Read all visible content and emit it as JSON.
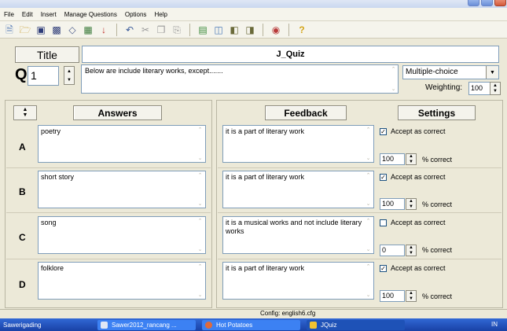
{
  "menu": [
    "File",
    "Edit",
    "Insert",
    "Manage Questions",
    "Options",
    "Help"
  ],
  "toolbar": {
    "icons": [
      "new-icon",
      "open-icon",
      "save-icon",
      "save-as-icon",
      "clear-icon",
      "export-icon",
      "insert-icon",
      "undo-icon",
      "cut-icon",
      "copy-icon",
      "paste-icon",
      "web-page-icon",
      "create-icon",
      "question-bank-icon",
      "quiz-icon",
      "tutorial-icon",
      "help-icon"
    ],
    "help_symbol": "?"
  },
  "title_label": "Title",
  "title_value": "J_Quiz",
  "question": {
    "label": "Q",
    "number": "1",
    "text": "Below are include literary works, except.......",
    "type": "Multiple-choice",
    "weighting_label": "Weighting:",
    "weighting": "100"
  },
  "headers": {
    "answers": "Answers",
    "feedback": "Feedback",
    "settings": "Settings"
  },
  "rows": [
    {
      "letter": "A",
      "answer": "poetry",
      "feedback": "it is a part of literary work",
      "accept_label": "Accept as correct",
      "accepted": true,
      "percent": "100",
      "percent_label": "% correct"
    },
    {
      "letter": "B",
      "answer": "short story",
      "feedback": "it is a part of literary work",
      "accept_label": "Accept as correct",
      "accepted": true,
      "percent": "100",
      "percent_label": "% correct"
    },
    {
      "letter": "C",
      "answer": "song",
      "feedback": "it is a musical works and not include literary works",
      "accept_label": "Accept as correct",
      "accepted": false,
      "percent": "0",
      "percent_label": "% correct"
    },
    {
      "letter": "D",
      "answer": "folklore",
      "feedback": "it is a part of literary work",
      "accept_label": "Accept as correct",
      "accepted": true,
      "percent": "100",
      "percent_label": "% correct"
    }
  ],
  "status": "Config: english6.cfg",
  "taskbar": [
    "Sawerigading",
    "Sawer2012_rancang ...",
    "Hot Potatoes",
    "JQuiz"
  ],
  "tray": "IN",
  "colors": {
    "taskbar": "#245edb",
    "window_bg": "#ece9d8",
    "field_border": "#7f9db9"
  }
}
